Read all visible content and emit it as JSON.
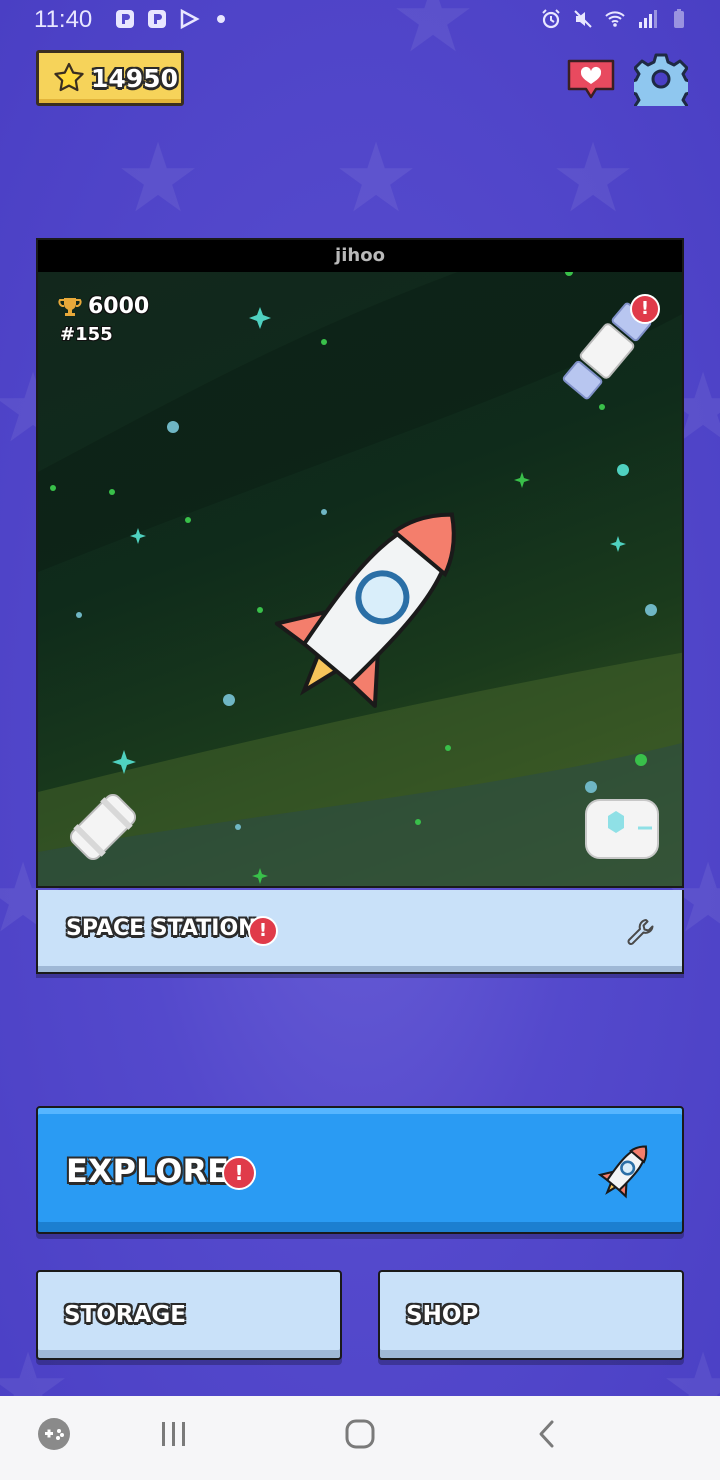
{
  "status_bar": {
    "time": "11:40",
    "left_icons": [
      "p-app-icon",
      "p-app-icon",
      "play-store-icon",
      "dot-icon"
    ],
    "right_icons": [
      "alarm-icon",
      "mute-icon",
      "wifi-icon",
      "signal-icon",
      "battery-icon"
    ]
  },
  "header": {
    "stars": "14950"
  },
  "station": {
    "owner": "jihoo",
    "trophies": "6000",
    "rank": "#155",
    "title": "SPACE STATION",
    "alert": "!"
  },
  "actions": {
    "explore_label": "EXPLORE",
    "explore_alert": "!",
    "storage_label": "STORAGE",
    "shop_label": "SHOP"
  },
  "colors": {
    "background": "#4a3fc6",
    "star_panel": "#f6d35a",
    "explore": "#2a9bf3",
    "light_button": "#c9e1f9",
    "alert": "#e03b4a"
  }
}
